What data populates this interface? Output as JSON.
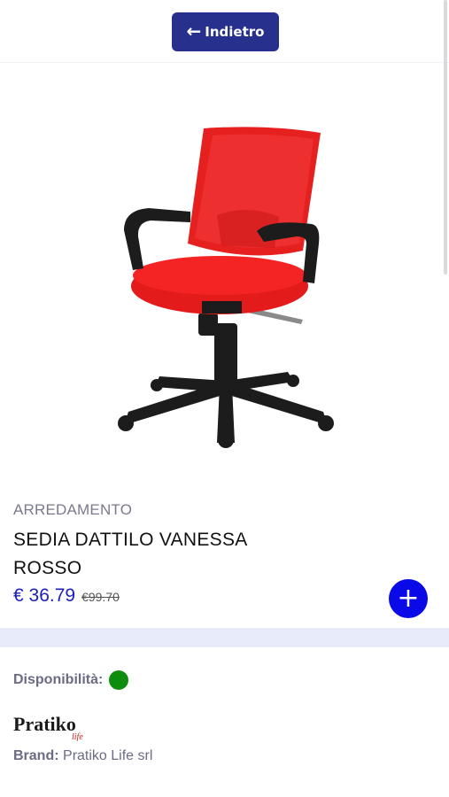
{
  "header": {
    "back_label": "Indietro",
    "back_icon": "left-arrow-icon"
  },
  "product": {
    "image_alt": "red office chair",
    "category": "ARREDAMENTO",
    "title": "SEDIA DATTILO VANESSA ROSSO",
    "price": "€ 36.79",
    "old_price": "€99.70",
    "add_icon": "plus-icon"
  },
  "details": {
    "availability_label": "Disponibilità:",
    "availability_status_color": "#0e8c0e",
    "brand_logo_text": "Pratiko",
    "brand_logo_sub": "life",
    "brand_label": "Brand:",
    "brand_value": "Pratiko Life srl"
  },
  "colors": {
    "accent": "#27308c",
    "price": "#1a1fb8",
    "add_button": "#0a09e8",
    "band": "#e8ecfa"
  }
}
